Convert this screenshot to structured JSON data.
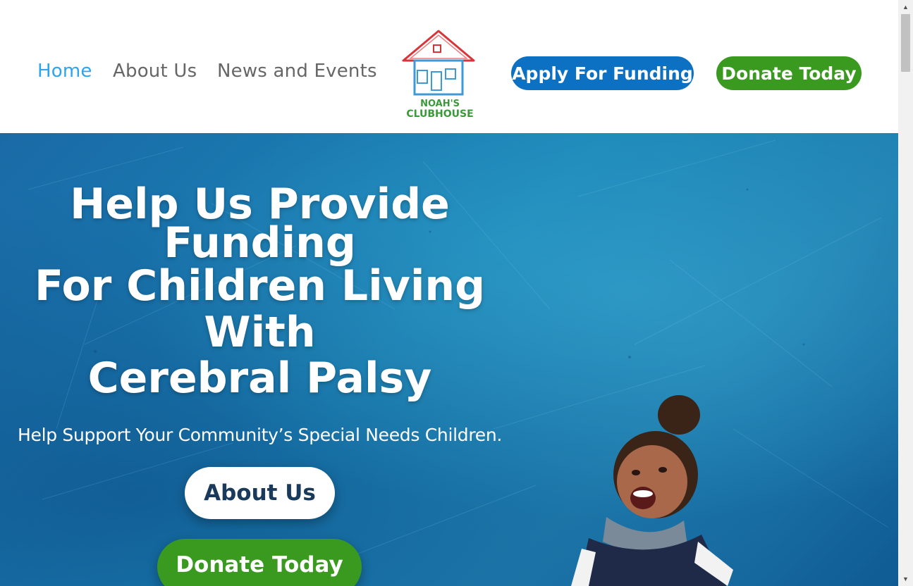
{
  "nav": {
    "home": "Home",
    "about": "About Us",
    "news": "News and Events"
  },
  "logo": {
    "line1": "NOAH'S",
    "line2": "CLUBHOUSE"
  },
  "header_buttons": {
    "apply": "Apply For Funding",
    "donate": "Donate Today"
  },
  "hero": {
    "title_line1": "Help Us Provide Funding",
    "title_line2": "For Children Living With",
    "title_line3": "Cerebral Palsy",
    "subtitle": "Help Support Your Community’s Special Needs Children.",
    "about_button": "About Us",
    "donate_button": "Donate Today"
  },
  "colors": {
    "nav_active": "#2ea3f2",
    "nav_text": "#666666",
    "apply_blue": "#0c71c3",
    "donate_green": "#3a9a1f",
    "hero_blue": "#1a86b8"
  },
  "icons": {
    "scroll_up": "▲",
    "scroll_down": "▼"
  }
}
